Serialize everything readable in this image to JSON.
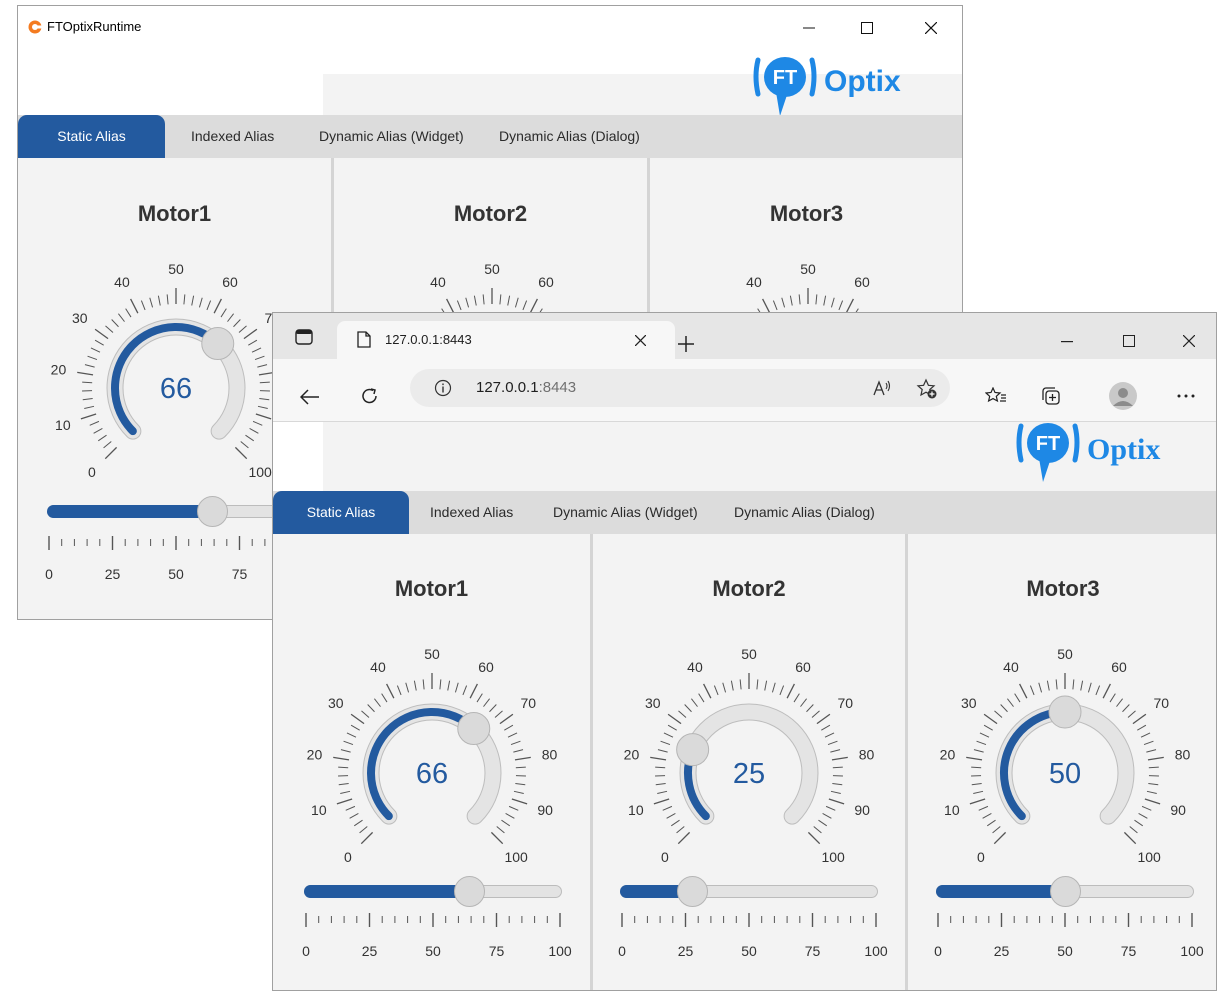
{
  "runtime_window": {
    "title": "FTOptixRuntime",
    "controls": {
      "minimize": "minimize-icon",
      "maximize": "maximize-icon",
      "close": "close-icon"
    },
    "logo": {
      "badge": "FT",
      "text": "Optix"
    },
    "tabs": [
      {
        "label": "Static Alias",
        "active": true
      },
      {
        "label": "Indexed Alias",
        "active": false
      },
      {
        "label": "Dynamic Alias (Widget)",
        "active": false
      },
      {
        "label": "Dynamic Alias (Dialog)",
        "active": false
      }
    ],
    "motors": [
      {
        "name": "Motor1",
        "value": "66"
      },
      {
        "name": "Motor2",
        "value": ""
      },
      {
        "name": "Motor3",
        "value": ""
      }
    ]
  },
  "browser_window": {
    "tab_title": "127.0.0.1:8443",
    "address": {
      "host": "127.0.0.1",
      "port": ":8443"
    },
    "toolbar_icons": [
      "sidebar-icon",
      "page-icon",
      "close-tab-icon",
      "new-tab-icon",
      "back-icon",
      "refresh-icon",
      "info-icon",
      "read-aloud-icon",
      "add-favorite-icon",
      "favorites-icon",
      "collections-icon",
      "profile-icon",
      "more-icon"
    ],
    "logo": {
      "badge": "FT",
      "text": "Optix"
    },
    "tabs": [
      {
        "label": "Static Alias",
        "active": true
      },
      {
        "label": "Indexed Alias",
        "active": false
      },
      {
        "label": "Dynamic Alias (Widget)",
        "active": false
      },
      {
        "label": "Dynamic Alias (Dialog)",
        "active": false
      }
    ],
    "motors": [
      {
        "name": "Motor1",
        "value": "66"
      },
      {
        "name": "Motor2",
        "value": "25"
      },
      {
        "name": "Motor3",
        "value": "50"
      }
    ]
  },
  "gauge_scale": {
    "min": 0,
    "max": 100,
    "labels": [
      "0",
      "10",
      "20",
      "30",
      "40",
      "50",
      "60",
      "70",
      "80",
      "90",
      "100"
    ]
  },
  "slider_scale": {
    "labels": [
      "0",
      "25",
      "50",
      "75",
      "100"
    ]
  },
  "colors": {
    "accent": "#235a9f",
    "tab_bar": "#dcdcdc",
    "panel": "#f3f3f3",
    "logo": "#1e88e5"
  }
}
